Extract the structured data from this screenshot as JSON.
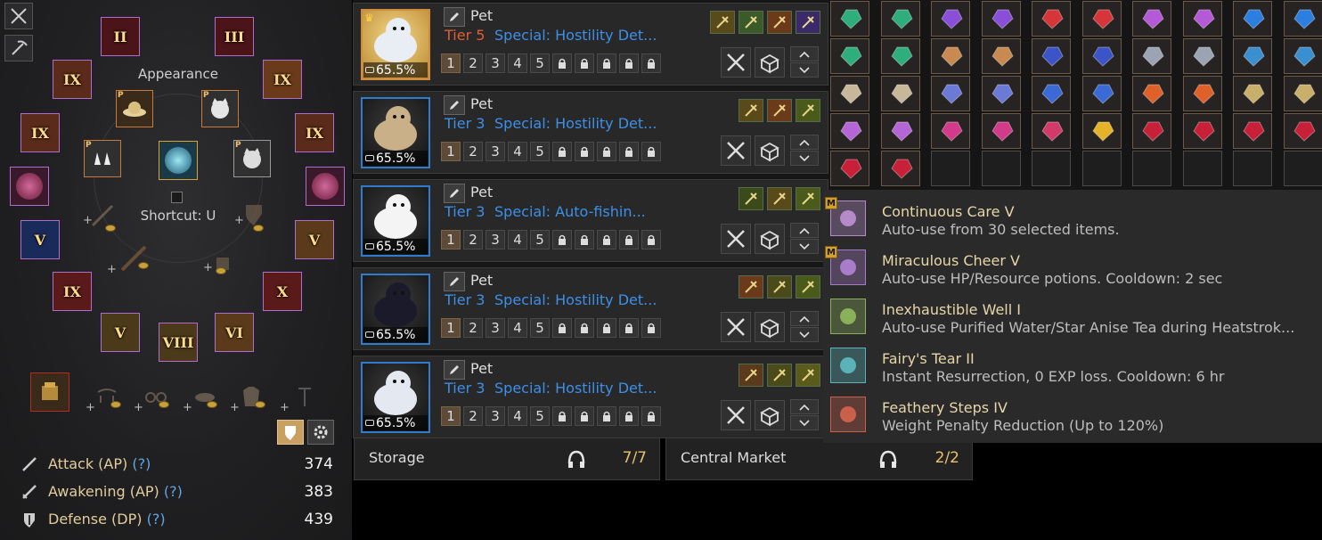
{
  "equipment": {
    "appearance_label": "Appearance",
    "shortcut_label": "Shortcut: U",
    "gear_slots": [
      {
        "name": "helmet",
        "roman": "II"
      },
      {
        "name": "armor",
        "roman": "III"
      },
      {
        "name": "necklace",
        "roman": "IX"
      },
      {
        "name": "earring-right",
        "roman": "IX"
      },
      {
        "name": "ring-left",
        "roman": "IX"
      },
      {
        "name": "ring-right",
        "roman": "IX"
      },
      {
        "name": "main-weapon",
        "roman": "V"
      },
      {
        "name": "subweapon",
        "roman": "V"
      },
      {
        "name": "belt",
        "roman": "IX"
      },
      {
        "name": "gloves",
        "roman": "X"
      },
      {
        "name": "shoes",
        "roman": "V"
      },
      {
        "name": "awakening-weapon",
        "roman": "VIII"
      },
      {
        "name": "accessory",
        "roman": "VI"
      }
    ],
    "appearance_slots": [
      {
        "name": "hat-outfit",
        "badge": "P"
      },
      {
        "name": "costume-outfit",
        "badge": "P"
      },
      {
        "name": "shoes-outfit",
        "badge": "P"
      },
      {
        "name": "pet-outfit",
        "badge": "P"
      }
    ],
    "stats": [
      {
        "label": "Attack (AP)",
        "help": "(?)",
        "value": "374"
      },
      {
        "label": "Awakening (AP)",
        "help": "(?)",
        "value": "383"
      },
      {
        "label": "Defense (DP)",
        "help": "(?)",
        "value": "439"
      }
    ]
  },
  "pets": [
    {
      "name": "Pet",
      "tier": "Tier 5",
      "special": "Special: Hostility Det...",
      "hunger": "65.5%",
      "levels": [
        "1",
        "2",
        "3",
        "4",
        "5"
      ],
      "locked_levels": 5,
      "hunger_pct": 65.5
    },
    {
      "name": "Pet",
      "tier": "Tier 3",
      "special": "Special: Hostility Det...",
      "hunger": "65.5%",
      "levels": [
        "1",
        "2",
        "3",
        "4",
        "5"
      ],
      "locked_levels": 5,
      "hunger_pct": 65.5
    },
    {
      "name": "Pet",
      "tier": "Tier 3",
      "special": "Special: Auto-fishin...",
      "hunger": "65.5%",
      "levels": [
        "1",
        "2",
        "3",
        "4",
        "5"
      ],
      "locked_levels": 5,
      "hunger_pct": 65.5
    },
    {
      "name": "Pet",
      "tier": "Tier 3",
      "special": "Special: Hostility Det...",
      "hunger": "65.5%",
      "levels": [
        "1",
        "2",
        "3",
        "4",
        "5"
      ],
      "locked_levels": 5,
      "hunger_pct": 65.5
    },
    {
      "name": "Pet",
      "tier": "Tier 3",
      "special": "Special: Hostility Det...",
      "hunger": "65.5%",
      "levels": [
        "1",
        "2",
        "3",
        "4",
        "5"
      ],
      "locked_levels": 5,
      "hunger_pct": 65.5
    }
  ],
  "storage": {
    "label": "Storage",
    "count": "7/7"
  },
  "market": {
    "label": "Central Market",
    "count": "2/2"
  },
  "items": {
    "rows": [
      [
        "#2fae7d",
        "#2fae7d",
        "#8a4fd8",
        "#8a4fd8",
        "#d6353a",
        "#d6353a",
        "#b45ad6",
        "#b45ad6",
        "#2c7ee0",
        "#2c7ee0"
      ],
      [
        "#2fae7d",
        "#2fae7d",
        "#c98a52",
        "#c98a52",
        "#3b55c8",
        "#3b55c8",
        "#9aa4b3",
        "#9aa4b3",
        "#3a8fd1",
        "#3a8fd1"
      ],
      [
        "#c8b89a",
        "#c8b89a",
        "#6a7ad6",
        "#6a7ad6",
        "#3a6ad6",
        "#3a6ad6",
        "#e0602a",
        "#e0602a",
        "#c9b06a",
        "#c9b06a"
      ],
      [
        "#b466d6",
        "#b466d6",
        "#d23a8a",
        "#d23a8a",
        "#d23a6a",
        "#e6b22a",
        "#c9203a",
        "#c9203a",
        "#c9203a",
        "#c9203a"
      ],
      [
        "#c9203a",
        "#c9203a",
        "",
        "",
        "",
        "",
        "",
        "",
        "",
        ""
      ]
    ]
  },
  "features": [
    {
      "title": "Continuous Care V",
      "desc": "Auto-use from 30 selected items.",
      "tag": "M",
      "color": "#b58ac8"
    },
    {
      "title": "Miraculous Cheer V",
      "desc": "Auto-use HP/Resource potions. Cooldown: 2 sec",
      "tag": "M",
      "color": "#a87cc8"
    },
    {
      "title": "Inexhaustible Well I",
      "desc": "Auto-use Purified Water/Star Anise Tea during Heatstrok...",
      "tag": "",
      "color": "#8bb05a"
    },
    {
      "title": "Fairy's Tear II",
      "desc": "Instant Resurrection, 0 EXP loss. Cooldown: 6 hr",
      "tag": "",
      "color": "#5ab3b8"
    },
    {
      "title": "Feathery Steps IV",
      "desc": "Weight Penalty Reduction (Up to 120%)",
      "tag": "",
      "color": "#c8604a"
    }
  ]
}
